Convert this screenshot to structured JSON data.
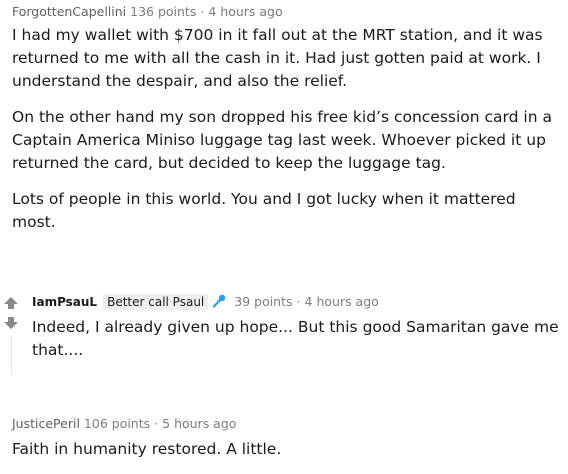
{
  "comments": [
    {
      "author": "ForgottenCapellini",
      "points": "136 points",
      "separator": "·",
      "time": "4 hours ago",
      "paragraphs": [
        "I had my wallet with $700 in it fall out at the MRT station, and it was returned to me with all the cash in it. Had just gotten paid at work. I understand the despair, and also the relief.",
        "On the other hand my son dropped his free kid’s concession card in a Captain America Miniso luggage tag last week. Whoever picked it up returned the card, but decided to keep the luggage tag.",
        "Lots of people in this world. You and I got lucky when it mattered most."
      ]
    },
    {
      "author": "IamPsauL",
      "flair": "Better call Psaul",
      "flair_icon": "microphone-icon",
      "points": "39 points",
      "separator": "·",
      "time": "4 hours ago",
      "paragraphs": [
        "Indeed, I already given up hope... But this good Samaritan gave me that...."
      ]
    },
    {
      "author": "JusticePeril",
      "points": "106 points",
      "separator": "·",
      "time": "5 hours ago",
      "paragraphs": [
        "Faith in humanity restored. A little."
      ]
    }
  ],
  "colors": {
    "meta_text": "#7c7c7c",
    "body_text": "#1a1a1b",
    "flair_bg": "#edeff1",
    "mic_icon": "#24a0ed",
    "arrow": "#878a8c"
  },
  "icons": {
    "upvote": "upvote-arrow-icon",
    "downvote": "downvote-arrow-icon"
  }
}
